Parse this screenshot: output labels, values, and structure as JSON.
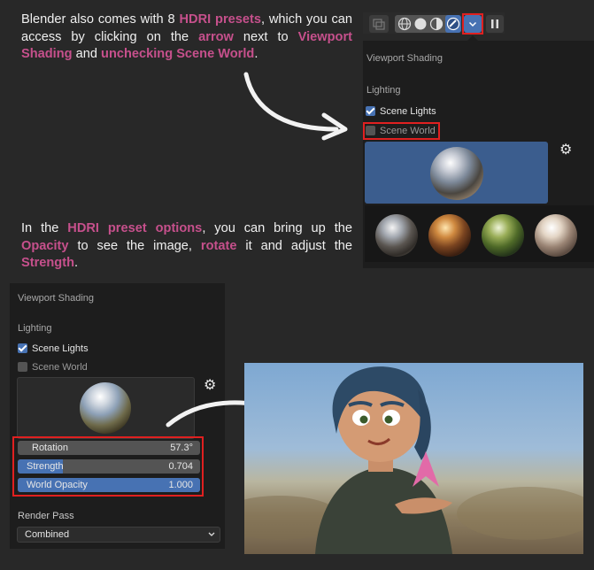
{
  "tutorial": {
    "para1": [
      {
        "t": "Blender also comes with 8 ",
        "h": false
      },
      {
        "t": "HDRI presets",
        "h": true
      },
      {
        "t": ", which you can access by clicking on the ",
        "h": false
      },
      {
        "t": "arrow",
        "h": true
      },
      {
        "t": " next to ",
        "h": false
      },
      {
        "t": "Viewport Shading",
        "h": true
      },
      {
        "t": " and ",
        "h": false
      },
      {
        "t": "unchecking Scene World",
        "h": true
      },
      {
        "t": ".",
        "h": false
      }
    ],
    "para2": [
      {
        "t": "In the ",
        "h": false
      },
      {
        "t": "HDRI preset options",
        "h": true
      },
      {
        "t": ", you can bring up the ",
        "h": false
      },
      {
        "t": "Opacity",
        "h": true
      },
      {
        "t": " to see the image, ",
        "h": false
      },
      {
        "t": "rotate",
        "h": true
      },
      {
        "t": " it and adjust the ",
        "h": false
      },
      {
        "t": "Strength",
        "h": true
      },
      {
        "t": ".",
        "h": false
      }
    ]
  },
  "popover_top": {
    "title": "Viewport Shading",
    "section": "Lighting",
    "scene_lights": {
      "label": "Scene Lights",
      "checked": true
    },
    "scene_world": {
      "label": "Scene World",
      "checked": false
    }
  },
  "popover_bottom": {
    "title": "Viewport Shading",
    "section": "Lighting",
    "scene_lights": {
      "label": "Scene Lights",
      "checked": true
    },
    "scene_world": {
      "label": "Scene World",
      "checked": false
    },
    "rotation": {
      "label": "Rotation",
      "value": "57.3°"
    },
    "strength": {
      "label": "Strength",
      "value": "0.704",
      "fill": 0.704
    },
    "world_opacity": {
      "label": "World Opacity",
      "value": "1.000",
      "fill": 1.0
    },
    "render_pass": {
      "label": "Render Pass",
      "value": "Combined"
    }
  },
  "colors": {
    "highlight": "#c6508c",
    "accent": "#4772b3",
    "red": "#e02020"
  }
}
